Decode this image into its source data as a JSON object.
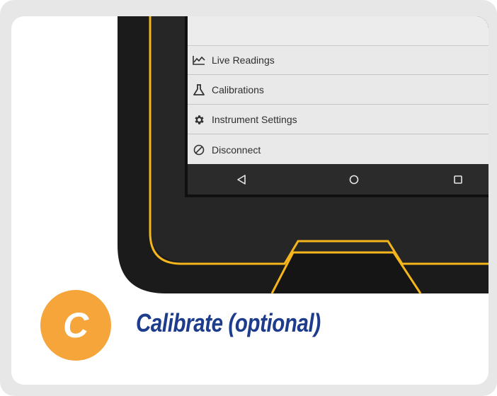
{
  "menu": {
    "items": [
      {
        "label": "Live Readings",
        "icon": "chart-line-icon"
      },
      {
        "label": "Calibrations",
        "icon": "flask-icon"
      },
      {
        "label": "Instrument Settings",
        "icon": "gear-icon"
      },
      {
        "label": "Disconnect",
        "icon": "block-icon"
      }
    ]
  },
  "navbar": {
    "back_icon": "back-triangle-icon",
    "home_icon": "home-circle-icon",
    "recents_icon": "recents-square-icon"
  },
  "step": {
    "letter": "C",
    "title": "Calibrate (optional)"
  },
  "colors": {
    "accent_orange": "#f6a53b",
    "device_yellow": "#f5b51d",
    "title_blue": "#1d3c8c",
    "device_body": "#1e1e1e"
  }
}
